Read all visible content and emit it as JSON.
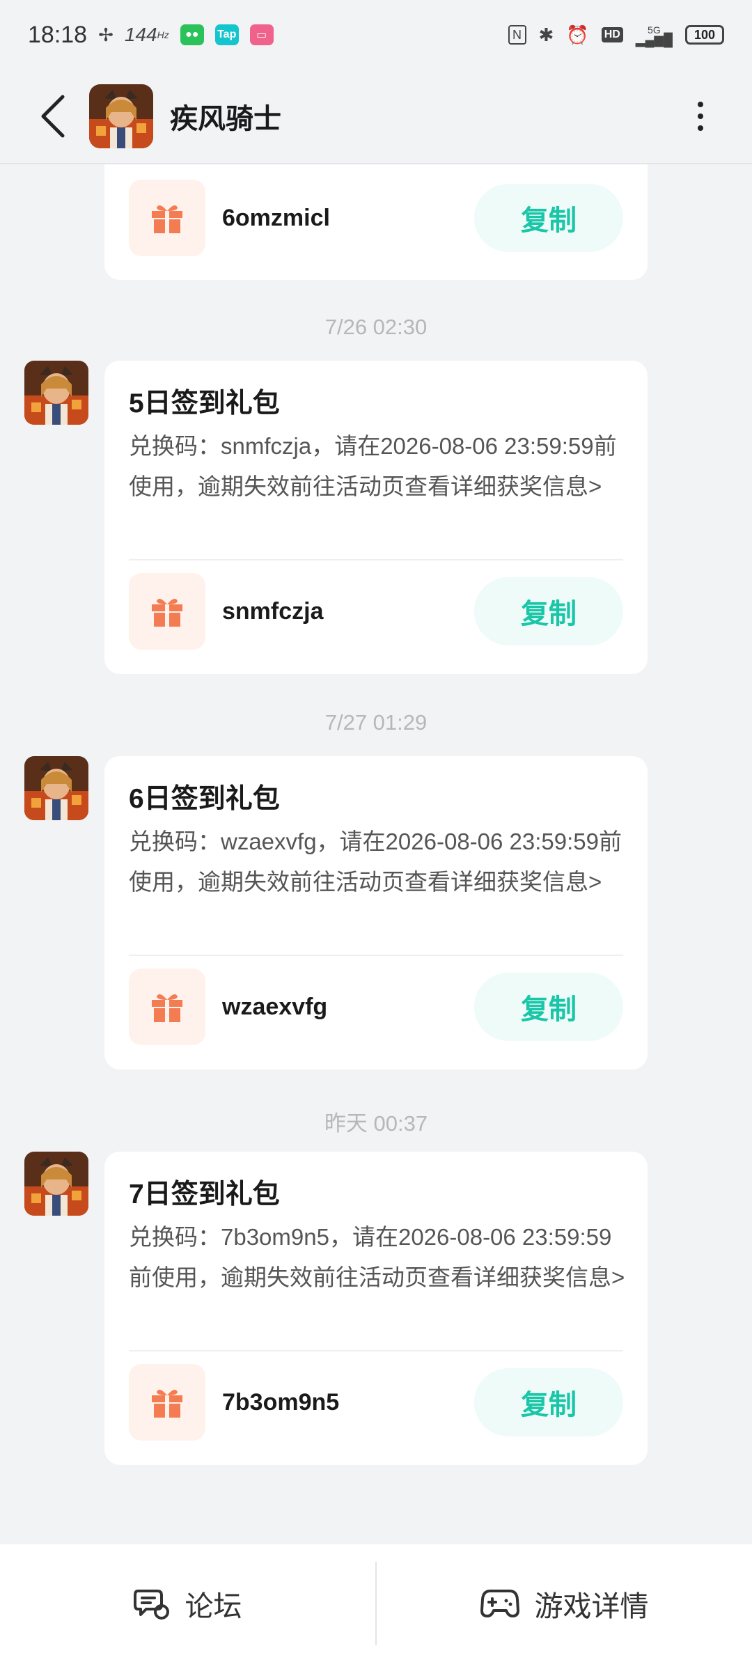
{
  "status_bar": {
    "time": "18:18",
    "refresh_rate": "144",
    "battery": "100",
    "network": "5G",
    "hd": "HD"
  },
  "header": {
    "title": "疾风骑士"
  },
  "cards": [
    {
      "code": "6omzmicl",
      "copy_label": "复制"
    },
    {
      "timestamp": "7/26  02:30",
      "title": "5日签到礼包",
      "description": "兑换码：snmfczja，请在2026-08-06 23:59:59前使用，逾期失效前往活动页查看详细获奖信息>",
      "code": "snmfczja",
      "copy_label": "复制"
    },
    {
      "timestamp": "7/27  01:29",
      "title": "6日签到礼包",
      "description": "兑换码：wzaexvfg，请在2026-08-06 23:59:59前使用，逾期失效前往活动页查看详细获奖信息>",
      "code": "wzaexvfg",
      "copy_label": "复制"
    },
    {
      "timestamp": "昨天  00:37",
      "title": "7日签到礼包",
      "description": "兑换码：7b3om9n5，请在2026-08-06 23:59:59前使用，逾期失效前往活动页查看详细获奖信息>",
      "code": "7b3om9n5",
      "copy_label": "复制"
    }
  ],
  "bottom_bar": {
    "forum_label": "论坛",
    "game_detail_label": "游戏详情"
  },
  "colors": {
    "accent": "#19c6a8",
    "gift": "#f47c52"
  }
}
